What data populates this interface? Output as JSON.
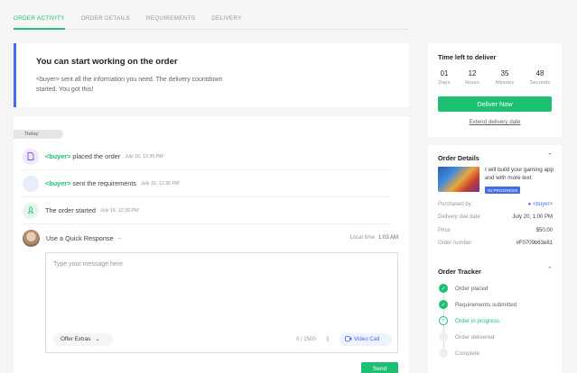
{
  "tabs": [
    "ORDER ACTIVITY",
    "ORDER DETAILS",
    "REQUIREMENTS",
    "DELIVERY"
  ],
  "banner": {
    "title": "You can start working on the order",
    "body": "<buyer> sent all the information you need. The delivery countdown started. You got this!"
  },
  "activity": {
    "day_label": "Today",
    "items": [
      {
        "actor": "<buyer>",
        "text": " placed the order",
        "time": "July 16, 12:35 PM",
        "icon": "document-icon"
      },
      {
        "actor": "<buyer>",
        "text": " sent the requirements",
        "time": "July 16, 12:36 PM",
        "icon": "user-circle-icon"
      },
      {
        "actor": "",
        "text": "The order started",
        "time": "July 16, 12:35 PM",
        "icon": "rocket-icon"
      }
    ],
    "quick_response": "Use a Quick Response",
    "quick_dash": "–",
    "local_time_label": "Local time",
    "local_time_value": "1:03 AM",
    "message_placeholder": "Type your message here",
    "offer_extras": "Offer Extras",
    "char_count": "0 / 2500",
    "video_call": "Video Call",
    "send": "Send"
  },
  "timer": {
    "title": "Time left to deliver",
    "units": [
      {
        "value": "01",
        "label": "Days"
      },
      {
        "value": "12",
        "label": "Hours"
      },
      {
        "value": "35",
        "label": "Minutes"
      },
      {
        "value": "48",
        "label": "Seconds"
      }
    ],
    "deliver_now": "Deliver Now",
    "extend": "Extend delivery date"
  },
  "order_details": {
    "title": "Order Details",
    "gig_title": "I will build your gaming app and with more text",
    "status_badge": "IN PROGRESS",
    "rows": [
      {
        "key": "Purchased by",
        "value": "<buyer>"
      },
      {
        "key": "Delivery due date",
        "value": "July 20, 1:00 PM"
      },
      {
        "key": "Price",
        "value": "$50.00"
      },
      {
        "key": "Order number",
        "value": "#F0709b63e81"
      }
    ]
  },
  "tracker": {
    "title": "Order Tracker",
    "steps": [
      {
        "label": "Order placed",
        "state": "done"
      },
      {
        "label": "Requirements submitted",
        "state": "done"
      },
      {
        "label": "Order in progress",
        "state": "current"
      },
      {
        "label": "Order delivered",
        "state": "todo"
      },
      {
        "label": "Complete",
        "state": "todo"
      }
    ]
  },
  "colors": {
    "accent": "#1dbf73",
    "link": "#446ee7",
    "text": "#404145",
    "muted": "#95979d"
  }
}
